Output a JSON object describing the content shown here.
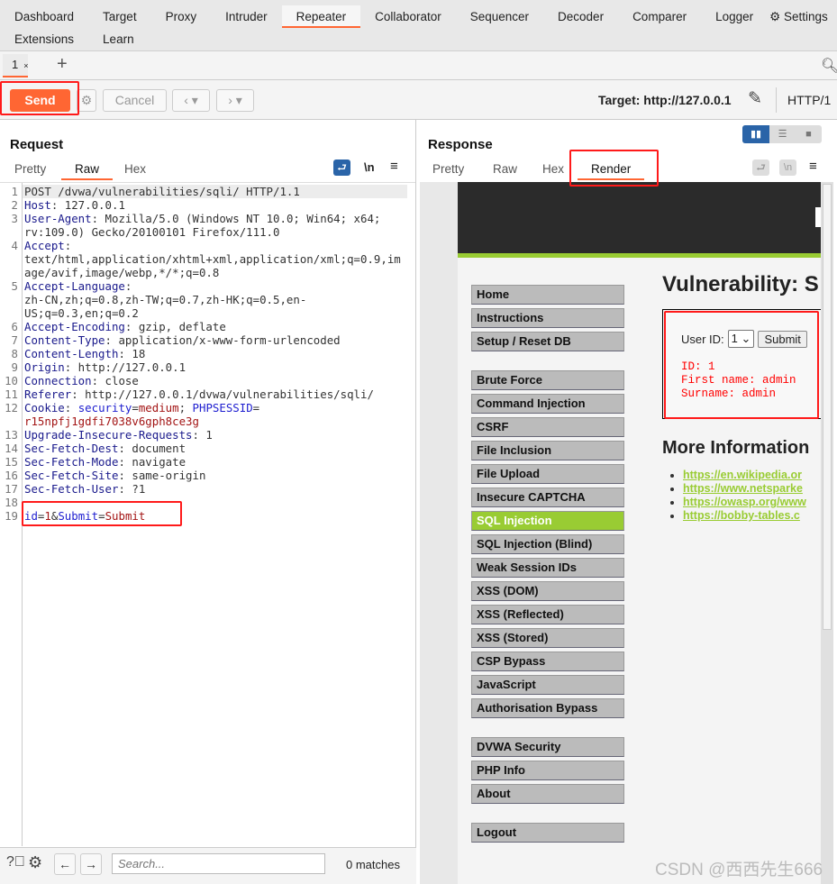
{
  "nav": {
    "row1": [
      "Dashboard",
      "Target",
      "Proxy",
      "Intruder",
      "Repeater",
      "Collaborator",
      "Sequencer",
      "Decoder",
      "Comparer",
      "Logger",
      "Settings"
    ],
    "row2": [
      "Extensions",
      "Learn"
    ],
    "active": "Repeater"
  },
  "tabs": {
    "items": [
      {
        "label": "1",
        "close": "×"
      }
    ],
    "add": "+"
  },
  "toolbar": {
    "send": "Send",
    "cancel": "Cancel",
    "target": "Target: http://127.0.0.1",
    "protocol": "HTTP/1"
  },
  "request": {
    "title": "Request",
    "tabs": [
      "Pretty",
      "Raw",
      "Hex"
    ],
    "active_tab": "Raw",
    "newline": "\\n",
    "lines": [
      [
        [
          "POST /dvwa/vulnerabilities/sqli/ HTTP/1.1",
          ""
        ]
      ],
      [
        [
          "Host",
          "k"
        ],
        [
          ": 127.0.0.1",
          ""
        ]
      ],
      [
        [
          "User-Agent",
          "k"
        ],
        [
          ": Mozilla/5.0 (Windows NT 10.0; Win64; x64; rv:109.0) Gecko/20100101 Firefox/111.0",
          ""
        ]
      ],
      [
        [
          "Accept",
          "k"
        ],
        [
          ":\ntext/html,application/xhtml+xml,application/xml;q=0.9,image/avif,image/webp,*/*;q=0.8",
          ""
        ]
      ],
      [
        [
          "Accept-Language",
          "k"
        ],
        [
          ":\nzh-CN,zh;q=0.8,zh-TW;q=0.7,zh-HK;q=0.5,en-US;q=0.3,en;q=0.2",
          ""
        ]
      ],
      [
        [
          "Accept-Encoding",
          "k"
        ],
        [
          ": gzip, deflate",
          ""
        ]
      ],
      [
        [
          "Content-Type",
          "k"
        ],
        [
          ": application/x-www-form-urlencoded",
          ""
        ]
      ],
      [
        [
          "Content-Length",
          "k"
        ],
        [
          ": 18",
          ""
        ]
      ],
      [
        [
          "Origin",
          "k"
        ],
        [
          ": http://127.0.0.1",
          ""
        ]
      ],
      [
        [
          "Connection",
          "k"
        ],
        [
          ": close",
          ""
        ]
      ],
      [
        [
          "Referer",
          "k"
        ],
        [
          ": http://127.0.0.1/dvwa/vulnerabilities/sqli/",
          ""
        ]
      ],
      [
        [
          "Cookie",
          "k"
        ],
        [
          ": ",
          ""
        ],
        [
          "security",
          "cb"
        ],
        [
          "=",
          ""
        ],
        [
          "medium",
          "cr"
        ],
        [
          "; ",
          ""
        ],
        [
          "PHPSESSID",
          "cb"
        ],
        [
          "=\n",
          ""
        ],
        [
          "r15npfj1gdfi7038v6gph8ce3g",
          "cr"
        ]
      ],
      [
        [
          "Upgrade-Insecure-Requests",
          "k"
        ],
        [
          ": 1",
          ""
        ]
      ],
      [
        [
          "Sec-Fetch-Dest",
          "k"
        ],
        [
          ": document",
          ""
        ]
      ],
      [
        [
          "Sec-Fetch-Mode",
          "k"
        ],
        [
          ": navigate",
          ""
        ]
      ],
      [
        [
          "Sec-Fetch-Site",
          "k"
        ],
        [
          ": same-origin",
          ""
        ]
      ],
      [
        [
          "Sec-Fetch-User",
          "k"
        ],
        [
          ": ?1",
          ""
        ]
      ],
      [
        [
          "",
          ""
        ]
      ],
      [
        [
          "id",
          "cb"
        ],
        [
          "=",
          ""
        ],
        [
          "1",
          "cr"
        ],
        [
          "&",
          ""
        ],
        [
          "Submit",
          "cb"
        ],
        [
          "=",
          ""
        ],
        [
          "Submit",
          "cr"
        ]
      ]
    ]
  },
  "search": {
    "placeholder": "Search...",
    "matches": "0 matches"
  },
  "response": {
    "title": "Response",
    "tabs": [
      "Pretty",
      "Raw",
      "Hex",
      "Render"
    ],
    "active_tab": "Render",
    "newline": "\\n"
  },
  "dvwa": {
    "menu1": [
      "Home",
      "Instructions",
      "Setup / Reset DB"
    ],
    "menu2": [
      "Brute Force",
      "Command Injection",
      "CSRF",
      "File Inclusion",
      "File Upload",
      "Insecure CAPTCHA",
      "SQL Injection",
      "SQL Injection (Blind)",
      "Weak Session IDs",
      "XSS (DOM)",
      "XSS (Reflected)",
      "XSS (Stored)",
      "CSP Bypass",
      "JavaScript",
      "Authorisation Bypass"
    ],
    "menu3": [
      "DVWA Security",
      "PHP Info",
      "About"
    ],
    "menu4": [
      "Logout"
    ],
    "active": "SQL Injection",
    "heading": "Vulnerability: S",
    "user_id_label": "User ID:",
    "user_id_value": "1",
    "submit": "Submit",
    "output": [
      "ID: 1",
      "First name: admin",
      "Surname: admin"
    ],
    "more_info": "More Information",
    "links": [
      "https://en.wikipedia.or",
      "https://www.netsparke",
      "https://owasp.org/www",
      "https://bobby-tables.c"
    ]
  },
  "watermark": "CSDN @西西先生666",
  "colors": {
    "accent": "#ff6633",
    "dvwa_green": "#99cc33",
    "annotation": "#ff1a1a"
  }
}
